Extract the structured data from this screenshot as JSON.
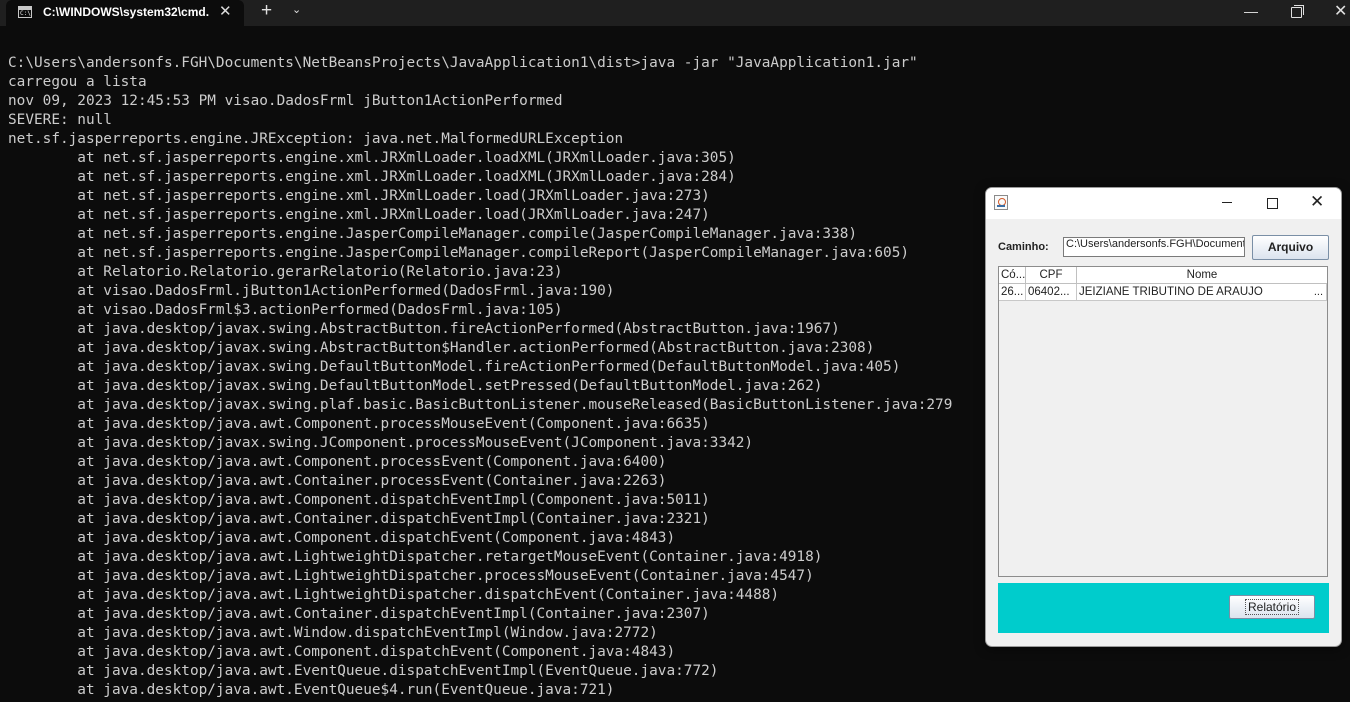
{
  "terminal": {
    "tab_title": "C:\\WINDOWS\\system32\\cmd.",
    "tab_icon_text": "C:\\",
    "tab_close": "✕",
    "new_tab": "+",
    "dropdown": "⌄",
    "window_controls": {
      "minimize": "—",
      "close": "✕"
    },
    "lines": [
      "C:\\Users\\andersonfs.FGH\\Documents\\NetBeansProjects\\JavaApplication1\\dist>java -jar \"JavaApplication1.jar\"",
      "carregou a lista",
      "nov 09, 2023 12:45:53 PM visao.DadosFrml jButton1ActionPerformed",
      "SEVERE: null",
      "net.sf.jasperreports.engine.JRException: java.net.MalformedURLException",
      "        at net.sf.jasperreports.engine.xml.JRXmlLoader.loadXML(JRXmlLoader.java:305)",
      "        at net.sf.jasperreports.engine.xml.JRXmlLoader.loadXML(JRXmlLoader.java:284)",
      "        at net.sf.jasperreports.engine.xml.JRXmlLoader.load(JRXmlLoader.java:273)",
      "        at net.sf.jasperreports.engine.xml.JRXmlLoader.load(JRXmlLoader.java:247)",
      "        at net.sf.jasperreports.engine.JasperCompileManager.compile(JasperCompileManager.java:338)",
      "        at net.sf.jasperreports.engine.JasperCompileManager.compileReport(JasperCompileManager.java:605)",
      "        at Relatorio.Relatorio.gerarRelatorio(Relatorio.java:23)",
      "        at visao.DadosFrml.jButton1ActionPerformed(DadosFrml.java:190)",
      "        at visao.DadosFrml$3.actionPerformed(DadosFrml.java:105)",
      "        at java.desktop/javax.swing.AbstractButton.fireActionPerformed(AbstractButton.java:1967)",
      "        at java.desktop/javax.swing.AbstractButton$Handler.actionPerformed(AbstractButton.java:2308)",
      "        at java.desktop/javax.swing.DefaultButtonModel.fireActionPerformed(DefaultButtonModel.java:405)",
      "        at java.desktop/javax.swing.DefaultButtonModel.setPressed(DefaultButtonModel.java:262)",
      "        at java.desktop/javax.swing.plaf.basic.BasicButtonListener.mouseReleased(BasicButtonListener.java:279",
      "        at java.desktop/java.awt.Component.processMouseEvent(Component.java:6635)",
      "        at java.desktop/javax.swing.JComponent.processMouseEvent(JComponent.java:3342)",
      "        at java.desktop/java.awt.Component.processEvent(Component.java:6400)",
      "        at java.desktop/java.awt.Container.processEvent(Container.java:2263)",
      "        at java.desktop/java.awt.Component.dispatchEventImpl(Component.java:5011)",
      "        at java.desktop/java.awt.Container.dispatchEventImpl(Container.java:2321)",
      "        at java.desktop/java.awt.Component.dispatchEvent(Component.java:4843)",
      "        at java.desktop/java.awt.LightweightDispatcher.retargetMouseEvent(Container.java:4918)",
      "        at java.desktop/java.awt.LightweightDispatcher.processMouseEvent(Container.java:4547)",
      "        at java.desktop/java.awt.LightweightDispatcher.dispatchEvent(Container.java:4488)",
      "        at java.desktop/java.awt.Container.dispatchEventImpl(Container.java:2307)",
      "        at java.desktop/java.awt.Window.dispatchEventImpl(Window.java:2772)",
      "        at java.desktop/java.awt.Component.dispatchEvent(Component.java:4843)",
      "        at java.desktop/java.awt.EventQueue.dispatchEventImpl(EventQueue.java:772)",
      "        at java.desktop/java.awt.EventQueue$4.run(EventQueue.java:721)"
    ]
  },
  "dialog": {
    "caminho_label": "Caminho:",
    "path_value": "C:\\Users\\andersonfs.FGH\\Documents",
    "arquivo_button": "Arquivo",
    "close_glyph": "✕",
    "table": {
      "columns": [
        "Có...",
        "CPF",
        "Nome"
      ],
      "rows": [
        {
          "codigo": "26...",
          "cpf": "06402...",
          "nome": "JEIZIANE TRIBUTINO DE ARAUJO",
          "more": "..."
        }
      ]
    },
    "relatorio_button": "Relatório",
    "panel_color": "#00cccc"
  }
}
